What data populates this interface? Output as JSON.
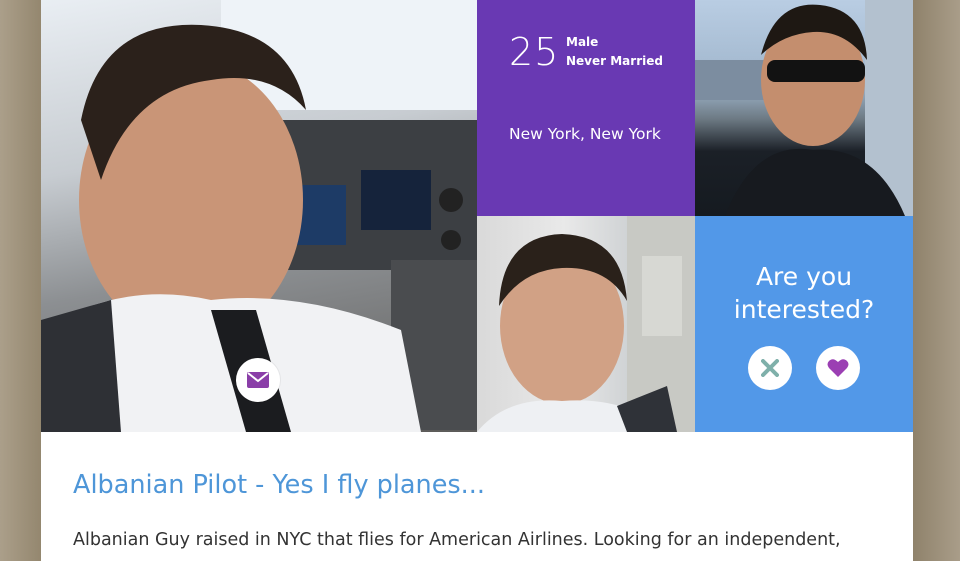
{
  "profile": {
    "age": "25",
    "gender": "Male",
    "marital_status": "Never Married",
    "location": "New York, New York",
    "headline": "Albanian Pilot - Yes I fly planes...",
    "bio": "Albanian Guy raised in NYC that flies for American Airlines. Looking for an independent,"
  },
  "interest": {
    "question": "Are you interested?",
    "no_icon": "x-icon",
    "yes_icon": "heart-icon"
  },
  "actions": {
    "message_icon": "envelope-icon"
  },
  "photos": [
    "pilot-selfie-cockpit",
    "selfie-bridge-sunglasses",
    "selfie-plane-cabin"
  ],
  "colors": {
    "info_tile": "#6939b3",
    "interest_tile": "#5298e8",
    "headline": "#4e96d8",
    "heart": "#9b3fb3",
    "x": "#7fb0aa",
    "envelope": "#8a3ea8"
  }
}
